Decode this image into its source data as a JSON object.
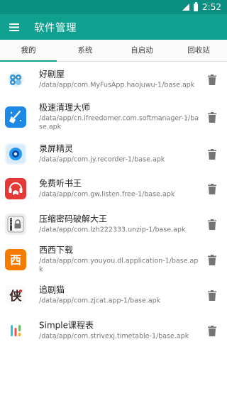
{
  "status_bar": {
    "time": "2:52"
  },
  "app_bar": {
    "title": "软件管理",
    "menu_icon": "hamburger-menu-icon"
  },
  "tabs": [
    {
      "label": "我的",
      "active": true
    },
    {
      "label": "系统",
      "active": false
    },
    {
      "label": "自启动",
      "active": false
    },
    {
      "label": "回收站",
      "active": false
    }
  ],
  "apps": [
    {
      "name": "好剧屋",
      "path": "/data/app/com.MyFusApp.haojuwu-1/base.apk",
      "icon": "haojuwu-app-icon"
    },
    {
      "name": "极速清理大师",
      "path": "/data/app/cn.ifreedomer.com.softmanager-1/base.apk",
      "icon": "broom-cleaner-app-icon"
    },
    {
      "name": "录屏精灵",
      "path": "/data/app/com.jy.recorder-1/base.apk",
      "icon": "screen-recorder-app-icon"
    },
    {
      "name": "免费听书王",
      "path": "/data/app/com.gw.listen.free-1/base.apk",
      "icon": "audiobook-app-icon"
    },
    {
      "name": "压缩密码破解大王",
      "path": "/data/app/com.lzh222333.unzip-1/base.apk",
      "icon": "zip-lock-app-icon"
    },
    {
      "name": "西西下载",
      "path": "/data/app/com.youyou.dl.application-1/base.apk",
      "icon": "xixi-download-app-icon"
    },
    {
      "name": "追剧猫",
      "path": "/data/app/com.zjcat.app-1/base.apk",
      "icon": "zhuijumao-app-icon"
    },
    {
      "name": "Simple课程表",
      "path": "/data/app/com.strivexj.timetable-1/base.apk",
      "icon": "timetable-app-icon"
    }
  ],
  "colors": {
    "status_bar": "#0a8f80",
    "app_bar": "#10a090",
    "tab_indicator": "#10a090"
  }
}
